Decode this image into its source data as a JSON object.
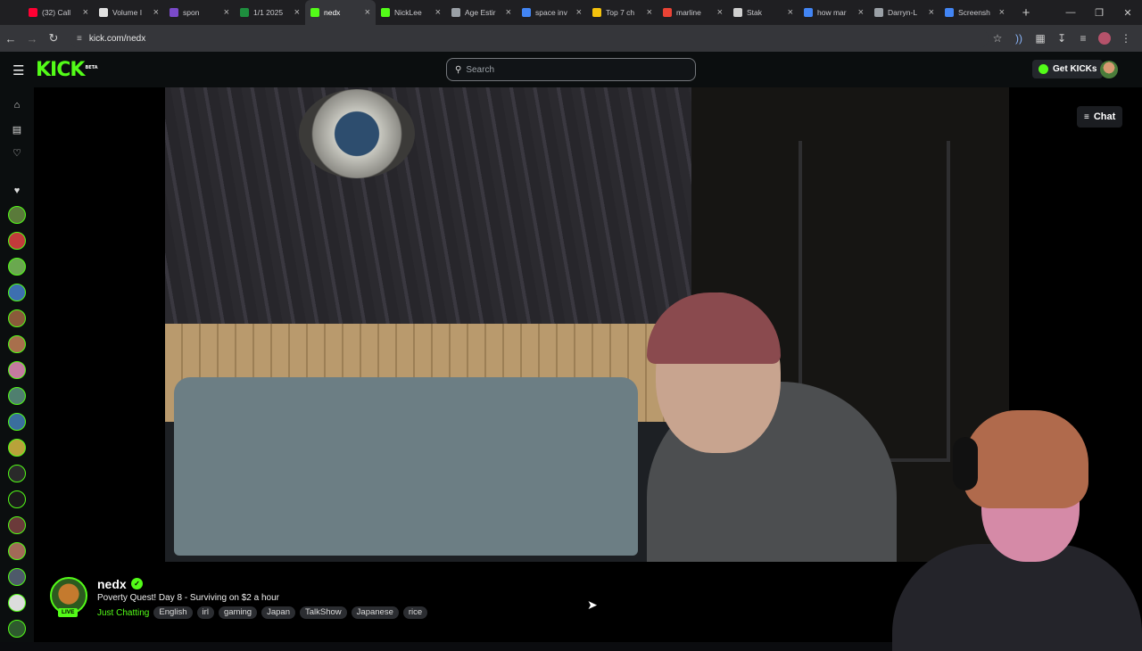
{
  "browser": {
    "tabs": [
      {
        "label": "(32) Call",
        "color": "#ff0033",
        "active": false
      },
      {
        "label": "Volume I",
        "color": "#e0e0e0",
        "active": false
      },
      {
        "label": "spon",
        "color": "#7a4ac9",
        "active": false
      },
      {
        "label": "1/1 2025",
        "color": "#1e8e3e",
        "active": false
      },
      {
        "label": "nedx",
        "color": "#53fc18",
        "active": true
      },
      {
        "label": "NickLee",
        "color": "#53fc18",
        "active": false
      },
      {
        "label": "Age Estir",
        "color": "#9aa0a6",
        "active": false
      },
      {
        "label": "space inv",
        "color": "#4285f4",
        "active": false
      },
      {
        "label": "Top 7 ch",
        "color": "#f4c20d",
        "active": false
      },
      {
        "label": "marline",
        "color": "#ea4335",
        "active": false
      },
      {
        "label": "Stak",
        "color": "#cfcfcf",
        "active": false
      },
      {
        "label": "how mar",
        "color": "#4285f4",
        "active": false
      },
      {
        "label": "Darryn-L",
        "color": "#9aa0a6",
        "active": false
      },
      {
        "label": "Screensh",
        "color": "#4285f4",
        "active": false
      }
    ],
    "new_tab": "+",
    "url": "kick.com/nedx"
  },
  "header": {
    "logo": "KICK",
    "logo_badge": "BETA",
    "search_placeholder": "Search",
    "get_kicks": "Get KICKs"
  },
  "player": {
    "chat_button": "Chat"
  },
  "stream": {
    "username": "nedx",
    "live_badge": "LIVE",
    "title": "Poverty Quest! Day 8 - Surviving on $2 a hour",
    "category": "Just Chatting",
    "tags": [
      "English",
      "irl",
      "gaming",
      "Japan",
      "TalkShow",
      "Japanese",
      "rice"
    ]
  },
  "colors": {
    "brand": "#53fc18",
    "background": "#0b0e0f"
  }
}
